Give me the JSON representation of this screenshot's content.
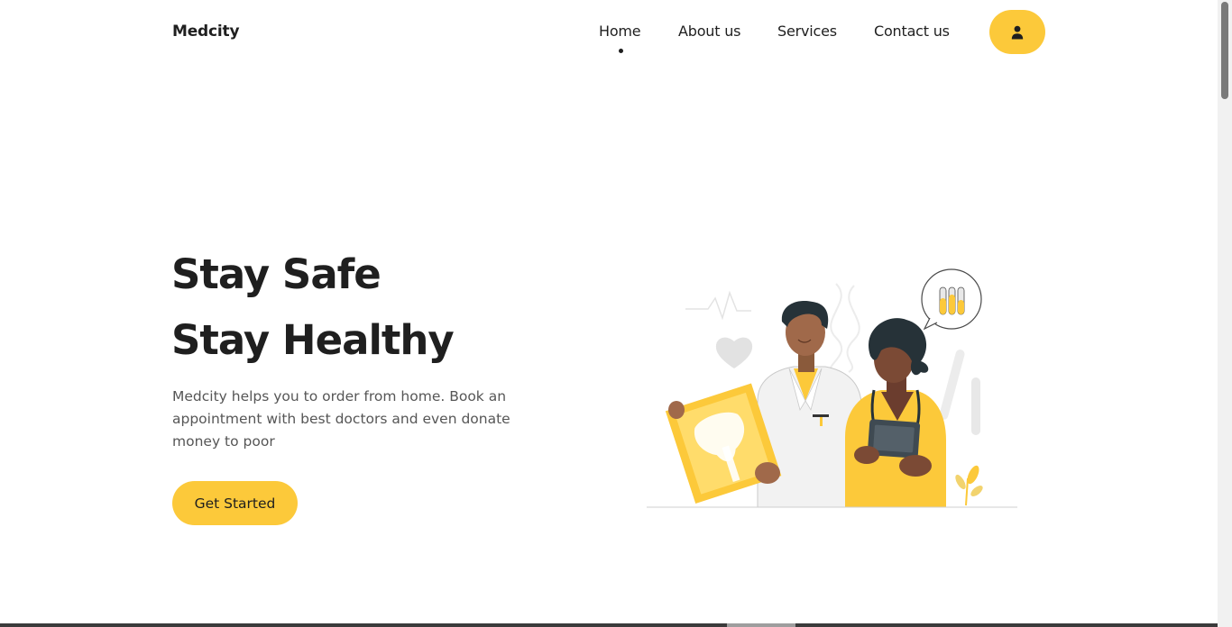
{
  "header": {
    "logo": "Medcity",
    "nav": [
      {
        "label": "Home",
        "active": true
      },
      {
        "label": "About us"
      },
      {
        "label": "Services"
      },
      {
        "label": "Contact us"
      }
    ],
    "profile_icon": "user-icon"
  },
  "hero": {
    "title_line1": "Stay Safe",
    "title_line2": "Stay Healthy",
    "description": "Medcity helps you to order from home. Book an appointment with best doctors and even donate money to poor",
    "cta_label": "Get Started",
    "illustration": "doctors-illustration"
  },
  "colors": {
    "accent": "#fcc93a",
    "text": "#1f1f1f",
    "muted": "#565656",
    "background": "#ffffff"
  }
}
